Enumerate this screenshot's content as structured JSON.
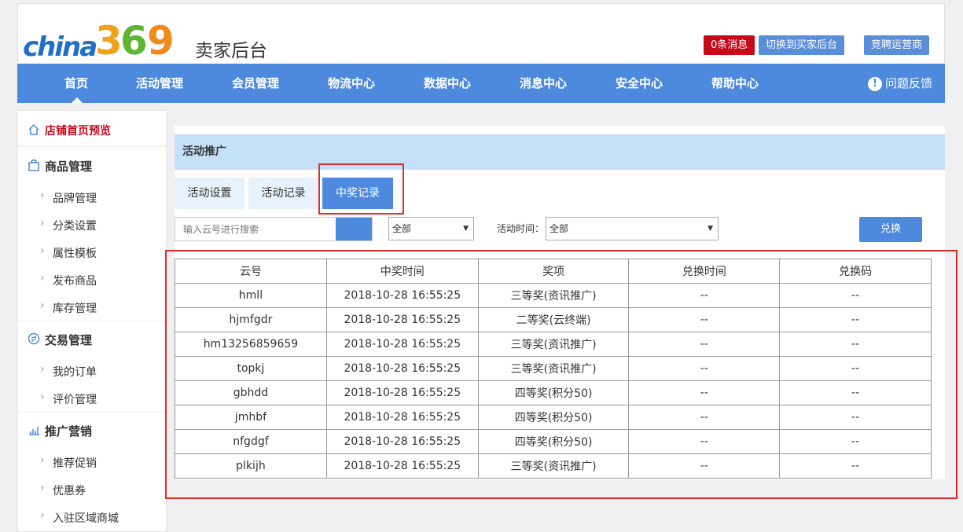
{
  "header": {
    "logo_text": "china369",
    "title": "卖家后台",
    "messages": "0条消息",
    "switch_buyer": "切换到买家后台",
    "recruit": "竞聘运营商"
  },
  "nav": {
    "items": [
      "首页",
      "活动管理",
      "会员管理",
      "物流中心",
      "数据中心",
      "消息中心",
      "安全中心",
      "帮助中心"
    ],
    "feedback": "问题反馈"
  },
  "sidebar": {
    "store_preview": "店铺首页预览",
    "goods": {
      "title": "商品管理",
      "items": [
        "品牌管理",
        "分类设置",
        "属性模板",
        "发布商品",
        "库存管理"
      ]
    },
    "trade": {
      "title": "交易管理",
      "items": [
        "我的订单",
        "评价管理"
      ]
    },
    "marketing": {
      "title": "推广营销",
      "items": [
        "推荐促销",
        "优惠券",
        "入驻区域商城"
      ]
    }
  },
  "main": {
    "section_title": "活动推广",
    "tabs": [
      "活动设置",
      "活动记录",
      "中奖记录"
    ],
    "search_placeholder": "输入云号进行搜索",
    "filter_value": "全部",
    "time_label": "活动时间：",
    "time_value": "全部",
    "exchange_btn": "兑换"
  },
  "table": {
    "headers": [
      "云号",
      "中奖时间",
      "奖项",
      "兑换时间",
      "兑换码"
    ],
    "rows": [
      [
        "hmll",
        "2018-10-28 16:55:25",
        "三等奖(资讯推广)",
        "--",
        "--"
      ],
      [
        "hjmfgdr",
        "2018-10-28 16:55:25",
        "二等奖(云终端)",
        "--",
        "--"
      ],
      [
        "hm13256859659",
        "2018-10-28 16:55:25",
        "三等奖(资讯推广)",
        "--",
        "--"
      ],
      [
        "topkj",
        "2018-10-28 16:55:25",
        "三等奖(资讯推广)",
        "--",
        "--"
      ],
      [
        "gbhdd",
        "2018-10-28 16:55:25",
        "四等奖(积分50)",
        "--",
        "--"
      ],
      [
        "jmhbf",
        "2018-10-28 16:55:25",
        "四等奖(积分50)",
        "--",
        "--"
      ],
      [
        "nfgdgf",
        "2018-10-28 16:55:25",
        "四等奖(积分50)",
        "--",
        "--"
      ],
      [
        "plkijh",
        "2018-10-28 16:55:25",
        "三等奖(资讯推广)",
        "--",
        "--"
      ]
    ]
  }
}
